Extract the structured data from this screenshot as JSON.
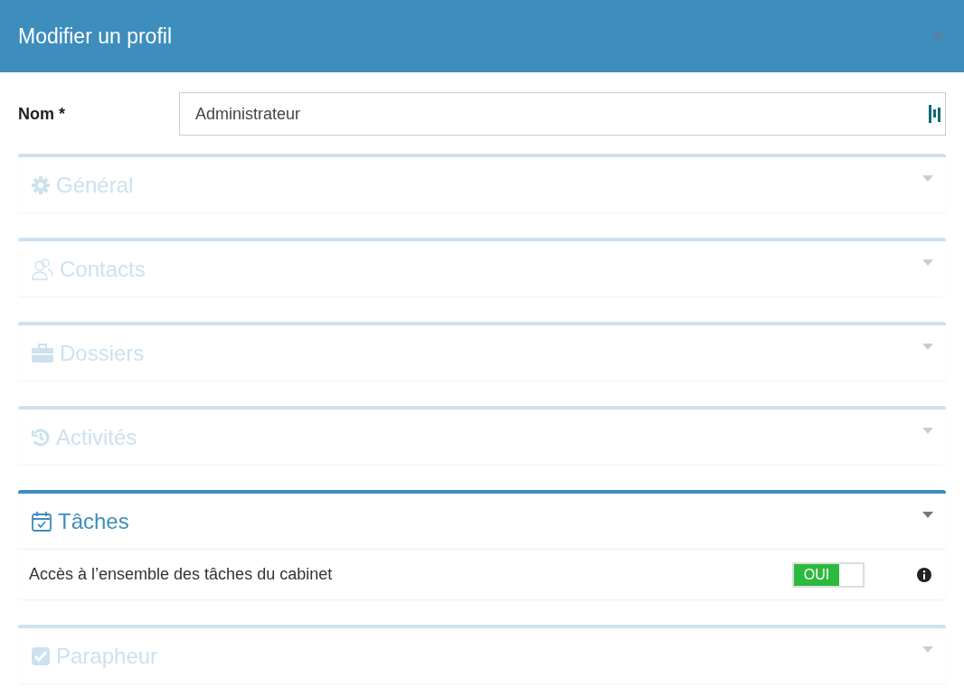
{
  "window": {
    "title": "Modifier un profil"
  },
  "name_field": {
    "label": "Nom *",
    "value": "Administrateur"
  },
  "sections": [
    {
      "title": "Général",
      "kind": "gear",
      "expanded": false
    },
    {
      "title": "Contacts",
      "kind": "contacts",
      "expanded": false
    },
    {
      "title": "Dossiers",
      "kind": "briefcase",
      "expanded": false
    },
    {
      "title": "Activités",
      "kind": "history",
      "expanded": false
    },
    {
      "title": "Tâches",
      "kind": "calendar",
      "expanded": true,
      "rows": [
        {
          "label": "Accès à l’ensemble des tâches du cabinet",
          "on": true,
          "toggle_text": "OUI"
        }
      ]
    },
    {
      "title": "Parapheur",
      "kind": "check",
      "expanded": false
    }
  ]
}
